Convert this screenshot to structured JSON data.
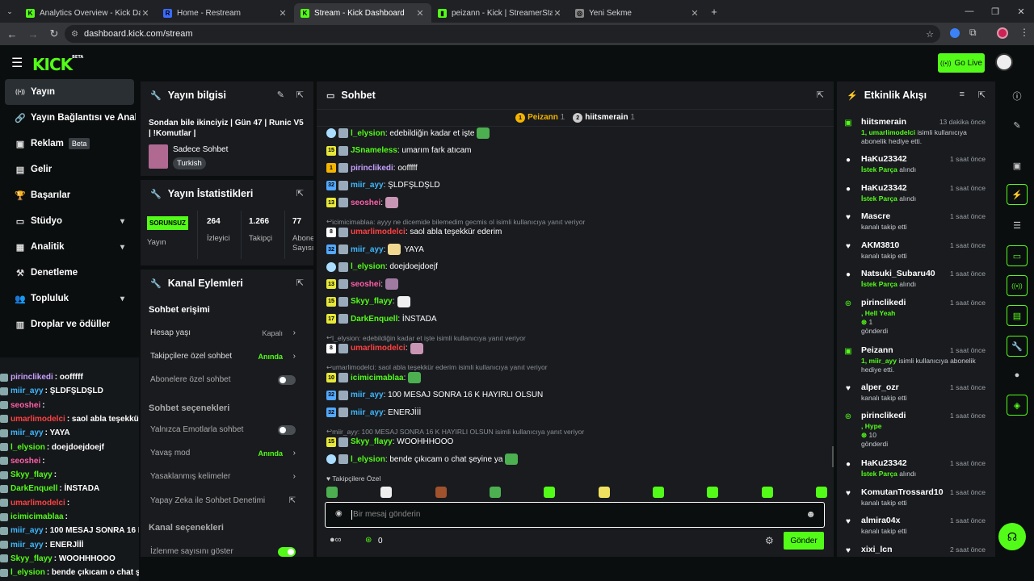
{
  "browser": {
    "tabs": [
      {
        "title": "Analytics Overview - Kick Dashb",
        "fav": "K",
        "favColor": "#53fc18"
      },
      {
        "title": "Home - Restream",
        "fav": "R",
        "favColor": "#3b6bff"
      },
      {
        "title": "Stream - Kick Dashboard",
        "fav": "K",
        "favColor": "#53fc18"
      },
      {
        "title": "peizann - Kick | StreamerStats",
        "fav": "▮",
        "favColor": "#53fc18"
      },
      {
        "title": "Yeni Sekme",
        "fav": "◎",
        "favColor": "#888888"
      }
    ],
    "url": "dashboard.kick.com/stream"
  },
  "header": {
    "logo": "KICK",
    "beta": "BETA",
    "go_live": "Go Live"
  },
  "sidebar": {
    "items": [
      {
        "label": "Yayın",
        "icon": "broadcast-icon",
        "glyph": "((•))"
      },
      {
        "label": "Yayın Bağlantısı ve Anahtarı",
        "icon": "link-icon",
        "glyph": "🔗"
      },
      {
        "label": "Reklam",
        "icon": "ad-icon",
        "glyph": "▣",
        "badge": "Beta"
      },
      {
        "label": "Gelir",
        "icon": "revenue-icon",
        "glyph": "▤"
      },
      {
        "label": "Başarılar",
        "icon": "trophy-icon",
        "glyph": "🏆"
      },
      {
        "label": "Stüdyo",
        "icon": "studio-icon",
        "glyph": "▭"
      },
      {
        "label": "Analitik",
        "icon": "analytics-icon",
        "glyph": "▦"
      },
      {
        "label": "Denetleme",
        "icon": "moderation-icon",
        "glyph": "⚒"
      },
      {
        "label": "Topluluk",
        "icon": "community-icon",
        "glyph": "👥"
      },
      {
        "label": "Droplar ve ödüller",
        "icon": "drops-icon",
        "glyph": "▥"
      }
    ]
  },
  "stream_info": {
    "title": "Yayın bilgisi",
    "stream_title": "Sondan bile ikinciyiz | Gün 47 | Runic V5 | !Komutlar |",
    "category": "Sadece Sohbet",
    "language": "Turkish"
  },
  "stats": {
    "title": "Yayın İstatistikleri",
    "status": "SORUNSUZ",
    "status_label": "Yayın",
    "viewers": "264",
    "viewers_label": "İzleyici",
    "followers": "1.266",
    "followers_label": "Takipçi",
    "subs": "77",
    "subs_label": "Abone Sayısı"
  },
  "channel_actions": {
    "title": "Kanal Eylemleri",
    "chat_access": "Sohbet erişimi",
    "account_age": "Hesap yaşı",
    "account_age_val": "Kapalı",
    "followers_only": "Takipçilere özel sohbet",
    "followers_only_val": "Anında",
    "subs_only": "Abonelere özel sohbet",
    "chat_options": "Sohbet seçenekleri",
    "emotes_only": "Yalnızca Emotlarla sohbet",
    "slow_mode": "Yavaş mod",
    "slow_mode_val": "Anında",
    "banned_words": "Yasaklanmış kelimeler",
    "ai_mod": "Yapay Zeka ile Sohbet Denetimi",
    "channel_options": "Kanal seçenekleri",
    "show_viewers": "İzlenme sayısını göster"
  },
  "chat": {
    "title": "Sohbet",
    "top1": "Peizann",
    "top1_count": "1",
    "top2": "hiitsmerain",
    "top2_count": "1",
    "messages": [
      {
        "user": "l_elysion",
        "color": "#53fc18",
        "text": ": edebildiğin kadar et işte",
        "badge": "#aaddff",
        "emote": "#4caf50"
      },
      {
        "user": "JSnameless",
        "color": "#53fc18",
        "text": ": umarım fark atıcam",
        "badge": "#e8e83a",
        "num": "15"
      },
      {
        "user": "pirinclikedi",
        "color": "#c8a0ff",
        "text": ": oofffff",
        "badge": "#f4b400",
        "num": "1"
      },
      {
        "user": "miir_ayy",
        "color": "#3fb8ff",
        "text": ": ŞLDFŞLDŞLD",
        "badge": "#53a8ff",
        "num": "32"
      },
      {
        "user": "seoshei",
        "color": "#ff5fa8",
        "text": ":",
        "badge": "#e8e83a",
        "num": "13",
        "emote": "#c896b4"
      },
      {
        "reply": "icimicimablaa: ayyy ne dicemide bilemedim gecmis ol isimli kullanıcıya yanıt veriyor"
      },
      {
        "user": "umarlimodelci",
        "color": "#ff4040",
        "text": ": saol abla teşekkür ederim",
        "badge": "#ffffff",
        "num": "8"
      },
      {
        "user": "miir_ayy",
        "color": "#3fb8ff",
        "text": ": YAYA",
        "badge": "#53a8ff",
        "num": "32",
        "emote": "#f0d890",
        "textAfter": true
      },
      {
        "user": "l_elysion",
        "color": "#53fc18",
        "text": ": doejdoejdoejf",
        "badge": "#aaddff"
      },
      {
        "user": "seoshei",
        "color": "#ff5fa8",
        "text": ":",
        "badge": "#e8e83a",
        "num": "13",
        "emote": "#a07aa0"
      },
      {
        "user": "Skyy_flayy",
        "color": "#53fc18",
        "text": ":",
        "badge": "#e8e83a",
        "num": "15",
        "emote": "#f0f0f0"
      },
      {
        "user": "DarkEnquell",
        "color": "#53fc18",
        "text": ": İNSTADA",
        "badge": "#e8e83a",
        "num": "17"
      },
      {
        "reply": "l_elysion: edebildiğin kadar et işte isimli kullanıcıya yanıt veriyor"
      },
      {
        "user": "umarlimodelci",
        "color": "#ff4040",
        "text": ":",
        "badge": "#ffffff",
        "num": "8",
        "emote": "#c896b4"
      },
      {
        "reply": "umarlimodelci: saol abla teşekkür ederim isimli kullanıcıya yanıt veriyor"
      },
      {
        "user": "icimicimablaa",
        "color": "#53fc18",
        "text": ":",
        "badge": "#e8e83a",
        "num": "10",
        "emote": "#4caf50"
      },
      {
        "user": "miir_ayy",
        "color": "#3fb8ff",
        "text": ": 100 MESAJ SONRA 16 K HAYIRLI OLSUN",
        "badge": "#53a8ff",
        "num": "32"
      },
      {
        "user": "miir_ayy",
        "color": "#3fb8ff",
        "text": ": ENERJİİİ",
        "badge": "#53a8ff",
        "num": "32"
      },
      {
        "reply": "miir_ayy: 100 MESAJ SONRA 16 K HAYIRLI OLSUN isimli kullanıcıya yanıt veriyor"
      },
      {
        "user": "Skyy_flayy",
        "color": "#53fc18",
        "text": ": WOOHHHOOO",
        "badge": "#e8e83a",
        "num": "15"
      },
      {
        "user": "l_elysion",
        "color": "#53fc18",
        "text": ": bende çıkıcam o chat şeyine ya",
        "badge": "#aaddff",
        "emote": "#4caf50"
      },
      {
        "user": "Peizann",
        "color": "#ff4040",
        "text": ":",
        "badge": "#53fc18",
        "emote": "#4caf50"
      }
    ],
    "emote_label": "Takipçilere Özel",
    "placeholder": "Bir mesaj gönderin",
    "points": "0",
    "send": "Gönder"
  },
  "activity": {
    "title": "Etkinlik Akışı",
    "items": [
      {
        "name": "hiitsmerain",
        "time": "13 dakika önce",
        "icon": "gift-icon",
        "g": "▣",
        "sub1": "1, umarlimodelci",
        "sub2": " isimli kullanıcıya abonelik hediye etti."
      },
      {
        "name": "HaKu23342",
        "time": "1 saat önce",
        "icon": "kicks-icon",
        "g": "●",
        "sub1": "İstek Parça",
        "sub2": " alındı"
      },
      {
        "name": "HaKu23342",
        "time": "1 saat önce",
        "icon": "kicks-icon",
        "g": "●",
        "sub1": "İstek Parça",
        "sub2": " alındı"
      },
      {
        "name": "Mascre",
        "time": "1 saat önce",
        "icon": "heart-icon",
        "g": "♥",
        "sub1": "",
        "sub2": "kanalı takip etti"
      },
      {
        "name": "AKM3810",
        "time": "1 saat önce",
        "icon": "heart-icon",
        "g": "♥",
        "sub1": "",
        "sub2": "kanalı takip etti"
      },
      {
        "name": "Natsuki_Subaru40",
        "time": "1 saat önce",
        "icon": "kicks-icon",
        "g": "●",
        "sub1": "İstek Parça",
        "sub2": " alındı"
      },
      {
        "name": "pirinclikedi",
        "time": "1 saat önce",
        "icon": "kicks-coin-icon",
        "g": "⊛",
        "sub1": ", Hell Yeah",
        "sub2": "1",
        "sub3": "gönderdi"
      },
      {
        "name": "Peizann",
        "time": "1 saat önce",
        "icon": "gift-icon",
        "g": "▣",
        "sub1": "1, miir_ayy",
        "sub2": " isimli kullanıcıya abonelik hediye etti."
      },
      {
        "name": "alper_ozr",
        "time": "1 saat önce",
        "icon": "heart-icon",
        "g": "♥",
        "sub1": "",
        "sub2": "kanalı takip etti"
      },
      {
        "name": "pirinclikedi",
        "time": "1 saat önce",
        "icon": "kicks-coin-icon",
        "g": "⊛",
        "sub1": ", Hype",
        "sub2": "10",
        "sub3": "gönderdi"
      },
      {
        "name": "HaKu23342",
        "time": "1 saat önce",
        "icon": "kicks-icon",
        "g": "●",
        "sub1": "İstek Parça",
        "sub2": " alındı"
      },
      {
        "name": "KomutanTrossard10",
        "time": "1 saat önce",
        "icon": "heart-icon",
        "g": "♥",
        "sub1": "",
        "sub2": "kanalı takip etti"
      },
      {
        "name": "almira04x",
        "time": "1 saat önce",
        "icon": "heart-icon",
        "g": "♥",
        "sub1": "",
        "sub2": "kanalı takip etti"
      },
      {
        "name": "xixi_lcn",
        "time": "2 saat önce",
        "icon": "heart-icon",
        "g": "♥",
        "sub1": "",
        "sub2": ""
      }
    ]
  },
  "overlay_chat": [
    {
      "user": "pirinclikedi",
      "color": "#c8a0ff",
      "text": ": oofffff"
    },
    {
      "user": "miir_ayy",
      "color": "#3fb8ff",
      "text": ": ŞLDFŞLDŞLD"
    },
    {
      "user": "seoshei",
      "color": "#ff5fa8",
      "text": ":"
    },
    {
      "user": "umarlimodelci",
      "color": "#ff4040",
      "text": ": saol abla teşekkür ederim"
    },
    {
      "user": "miir_ayy",
      "color": "#3fb8ff",
      "text": ": YAYA"
    },
    {
      "user": "l_elysion",
      "color": "#53fc18",
      "text": ": doejdoejdoejf"
    },
    {
      "user": "seoshei",
      "color": "#ff5fa8",
      "text": ":"
    },
    {
      "user": "Skyy_flayy",
      "color": "#53fc18",
      "text": ":"
    },
    {
      "user": "DarkEnquell",
      "color": "#53fc18",
      "text": ": İNSTADA"
    },
    {
      "user": "umarlimodelci",
      "color": "#ff4040",
      "text": ":"
    },
    {
      "user": "icimicimablaa",
      "color": "#53fc18",
      "text": ":"
    },
    {
      "user": "miir_ayy",
      "color": "#3fb8ff",
      "text": ": 100 MESAJ SONRA 16 K HAYIRLI OLSUN"
    },
    {
      "user": "miir_ayy",
      "color": "#3fb8ff",
      "text": ": ENERJİİİ"
    },
    {
      "user": "Skyy_flayy",
      "color": "#53fc18",
      "text": ": WOOHHHOOO"
    },
    {
      "user": "l_elysion",
      "color": "#53fc18",
      "text": ": bende çıkıcam o chat şeyine ya"
    }
  ]
}
